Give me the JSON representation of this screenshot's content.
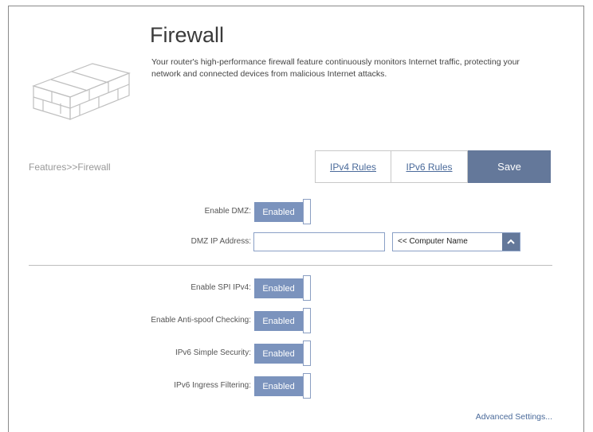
{
  "header": {
    "title": "Firewall",
    "description": "Your router's high-performance firewall feature continuously monitors Internet traffic, protecting your network and connected devices from malicious Internet attacks."
  },
  "breadcrumb": "Features>>Firewall",
  "tabs": {
    "ipv4": "IPv4 Rules",
    "ipv6": "IPv6 Rules",
    "save": "Save"
  },
  "dmz": {
    "enable_label": "Enable DMZ:",
    "enable_value": "Enabled",
    "ip_label": "DMZ IP Address:",
    "ip_value": "",
    "computer_select": "<< Computer Name"
  },
  "settings": [
    {
      "label": "Enable SPI IPv4:",
      "value": "Enabled"
    },
    {
      "label": "Enable Anti-spoof Checking:",
      "value": "Enabled"
    },
    {
      "label": "IPv6 Simple Security:",
      "value": "Enabled"
    },
    {
      "label": "IPv6 Ingress Filtering:",
      "value": "Enabled"
    }
  ],
  "advanced_link": "Advanced Settings...",
  "colors": {
    "accent": "#64789a",
    "toggle_on": "#7b93bd",
    "link": "#4a6a9a"
  }
}
